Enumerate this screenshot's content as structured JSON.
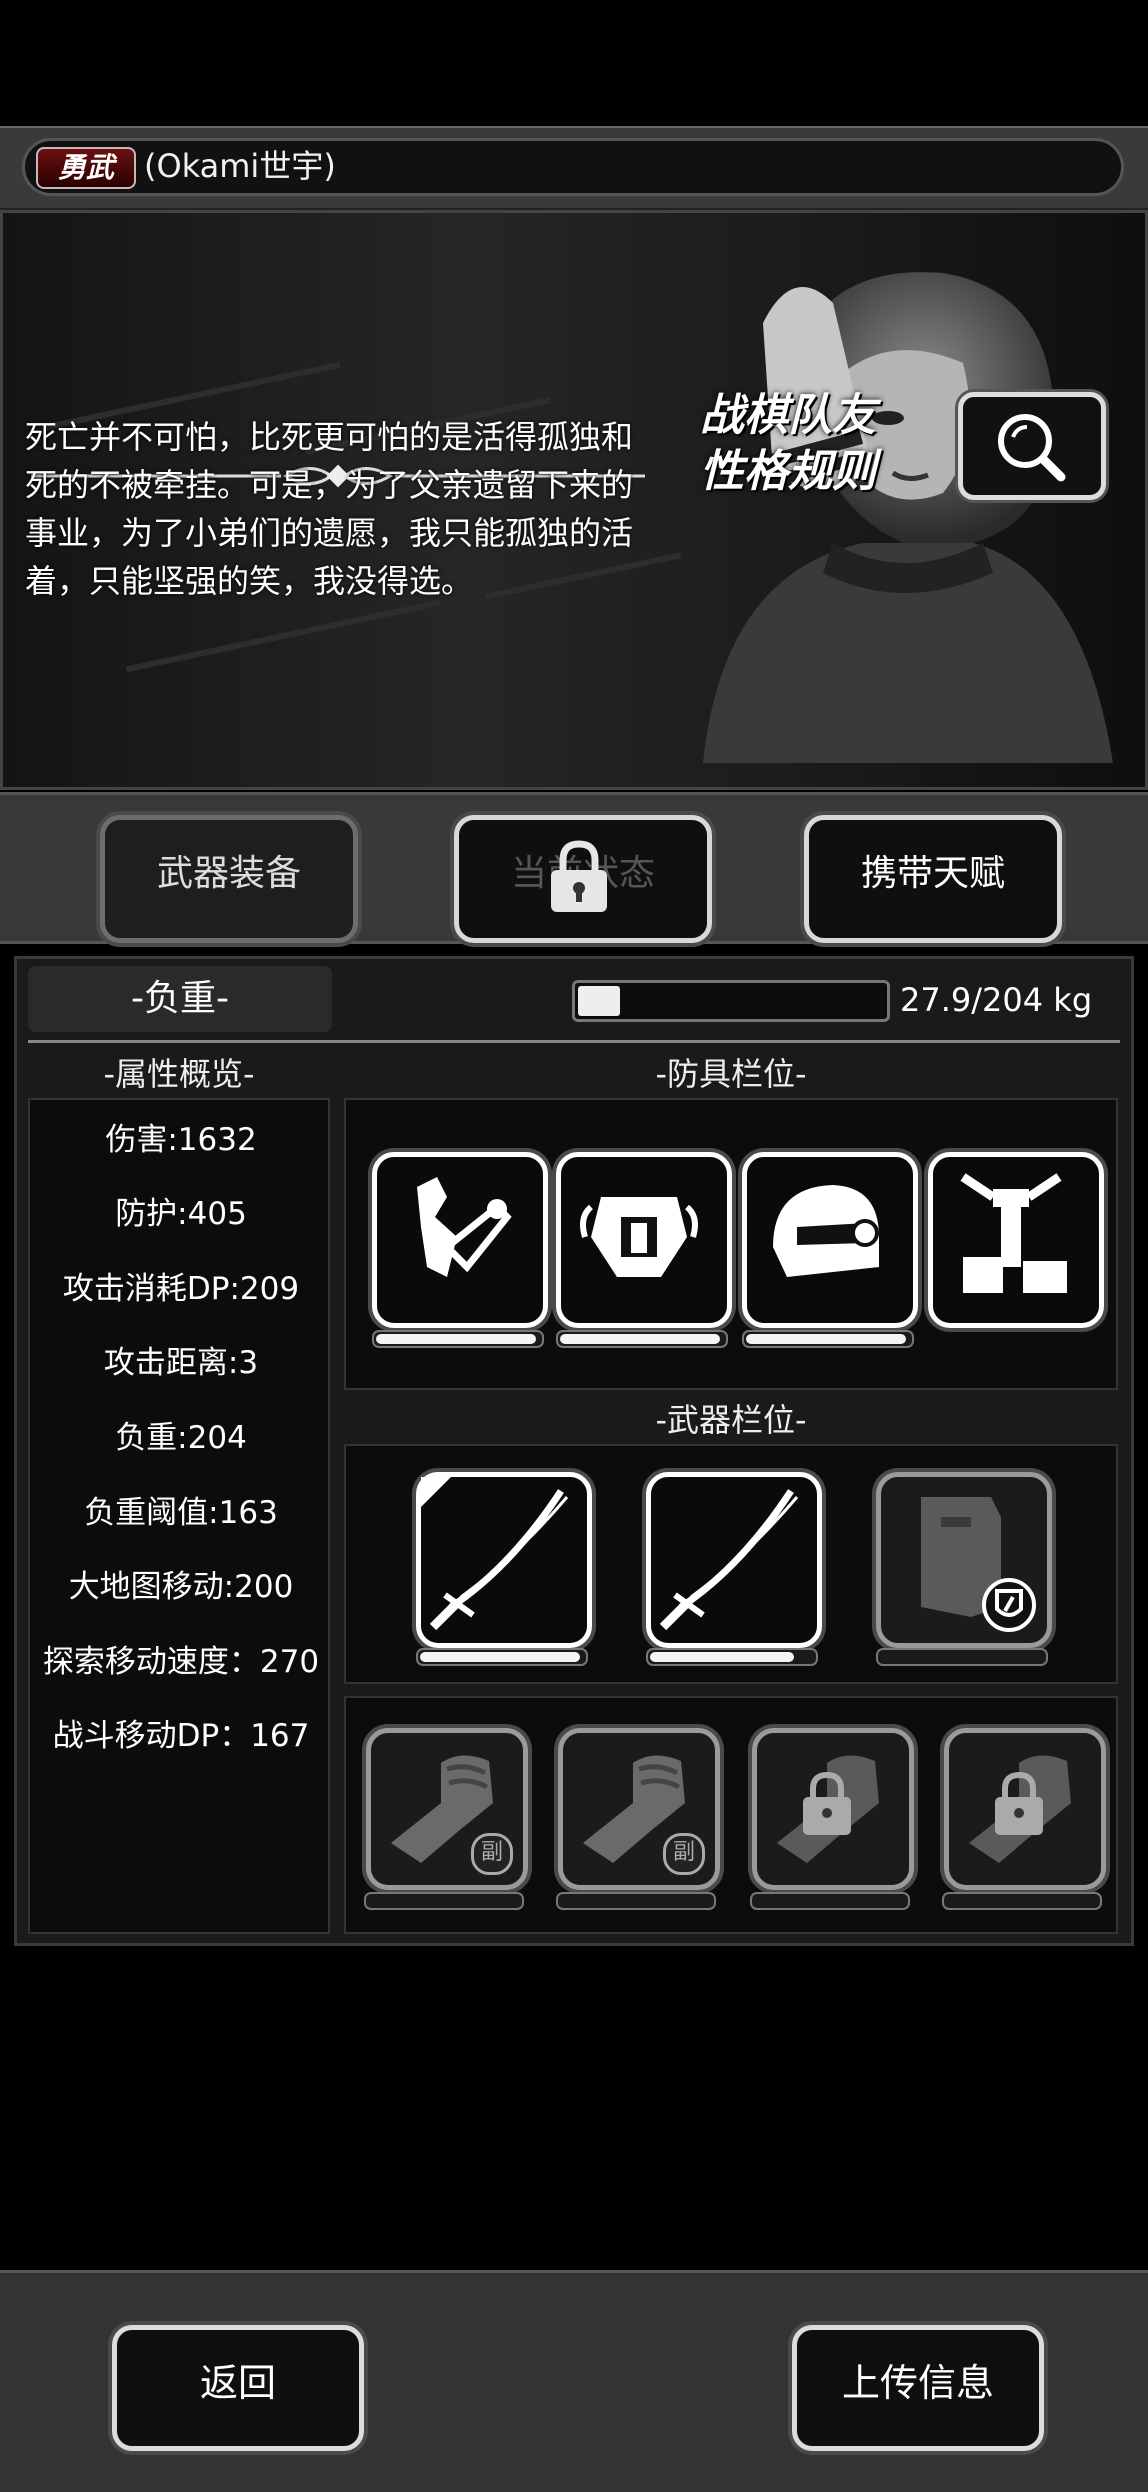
{
  "header": {
    "rank_badge": "勇武",
    "player_name": "(Okami世宇)"
  },
  "story": {
    "quote": "死亡并不可怕，比死更可怕的是活得孤独和死的不被牵挂。可是，为了父亲遗留下来的事业，为了小弟们的遗愿，我只能孤独的活着，只能坚强的笑，我没得选。",
    "rule_label_line1": "战棋队友",
    "rule_label_line2": "性格规则",
    "search_icon": "magnifier-icon"
  },
  "tabs": [
    {
      "label": "武器装备",
      "state": "selected"
    },
    {
      "label": "当前状态",
      "state": "locked",
      "icon": "lock-icon"
    },
    {
      "label": "携带天赋",
      "state": "normal"
    }
  ],
  "load": {
    "label": "-负重-",
    "text": "27.9/204 kg",
    "fraction": 0.137
  },
  "sections": {
    "stats_title": "-属性概览-",
    "armor_title": "-防具栏位-",
    "weapon_title": "-武器栏位-"
  },
  "stats": [
    "伤害:1632",
    "防护:405",
    "攻击消耗DP:209",
    "攻击距离:3",
    "负重:204",
    "负重阈值:163",
    "大地图移动:200",
    "探索移动速度：270",
    "战斗移动DP：167"
  ],
  "armor_slots": [
    {
      "icon": "arm-guard-icon",
      "durability": 0.98
    },
    {
      "icon": "chest-armor-icon",
      "durability": 0.98
    },
    {
      "icon": "helmet-icon",
      "durability": 0.98
    },
    {
      "icon": "exoskeleton-legs-icon",
      "durability": null
    }
  ],
  "weapon_slots": [
    {
      "icon": "katana-icon",
      "durability": 0.98,
      "corner_mark": true
    },
    {
      "icon": "katana-icon",
      "durability": 0.88
    },
    {
      "icon": "riot-shield-icon",
      "durability": 0.0,
      "badge": "shield-badge-icon"
    }
  ],
  "skill_slots": [
    {
      "icon": "fist-icon",
      "badge": "副",
      "locked": false
    },
    {
      "icon": "fist-icon",
      "badge": "副",
      "locked": false
    },
    {
      "icon": "fist-icon",
      "locked": true
    },
    {
      "icon": "fist-icon",
      "locked": true
    }
  ],
  "buttons": {
    "back": "返回",
    "upload": "上传信息"
  }
}
